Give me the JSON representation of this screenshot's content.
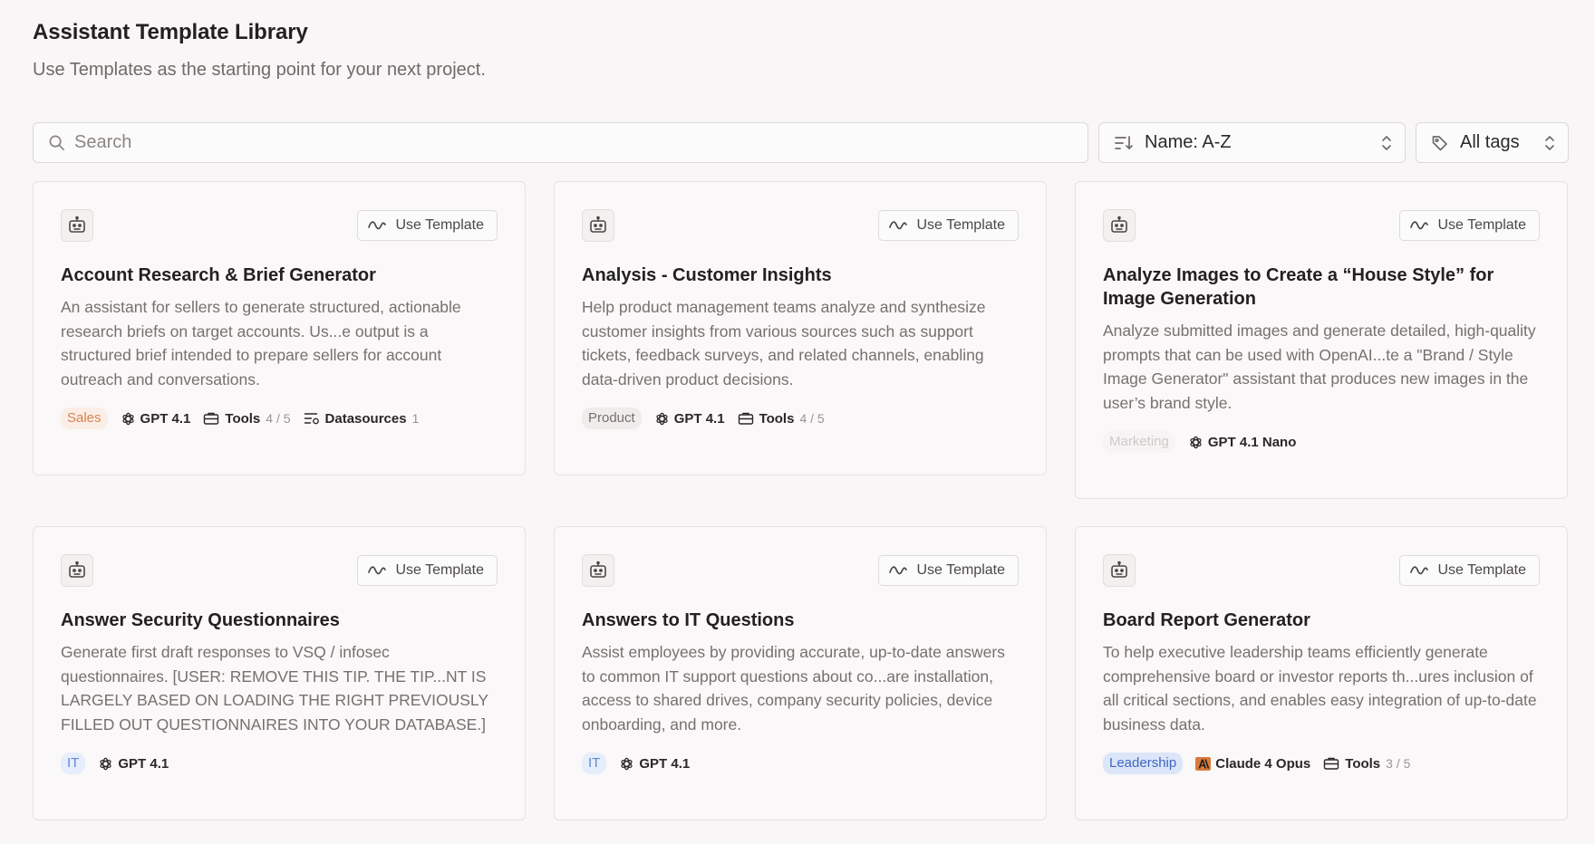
{
  "header": {
    "title": "Assistant Template Library",
    "subtitle": "Use Templates as the starting point for your next project."
  },
  "toolbar": {
    "search_placeholder": "Search",
    "sort_label": "Name: A-Z",
    "tags_label": "All tags"
  },
  "use_template_label": "Use Template",
  "cards": [
    {
      "title": "Account Research & Brief Generator",
      "description": "An assistant for sellers to generate structured, actionable research briefs on target accounts. Us...e output is a structured brief intended to prepare sellers for account outreach and conversations.",
      "tag": "Sales",
      "model": "GPT 4.1",
      "tools_label": "Tools",
      "tools_count": "4 / 5",
      "datasources_label": "Datasources",
      "datasources_count": "1"
    },
    {
      "title": "Analysis - Customer Insights",
      "description": "Help product management teams analyze and synthesize customer insights from various sources such as support tickets, feedback surveys, and related channels, enabling data-driven product decisions.",
      "tag": "Product",
      "model": "GPT 4.1",
      "tools_label": "Tools",
      "tools_count": "4 / 5"
    },
    {
      "title": "Analyze Images to Create a “House Style” for Image Generation",
      "description": "Analyze submitted images and generate detailed, high-quality prompts that can be used with OpenAI...te a \"Brand / Style Image Generator\" assistant that produces new images in the user’s brand style.",
      "tag": "Marketing",
      "model": "GPT 4.1 Nano"
    },
    {
      "title": "Answer Security Questionnaires",
      "description": "Generate first draft responses to VSQ / infosec questionnaires. [USER: REMOVE THIS TIP. THE TIP...NT IS LARGELY BASED ON LOADING THE RIGHT PREVIOUSLY FILLED OUT QUESTIONNAIRES INTO YOUR DATABASE.]",
      "tag": "IT",
      "model": "GPT 4.1"
    },
    {
      "title": "Answers to IT Questions",
      "description": "Assist employees by providing accurate, up-to-date answers to common IT support questions about co...are installation, access to shared drives, company security policies, device onboarding, and more.",
      "tag": "IT",
      "model": "GPT 4.1"
    },
    {
      "title": "Board Report Generator",
      "description": "To help executive leadership teams efficiently generate comprehensive board or investor reports th...ures inclusion of all critical sections, and enables easy integration of up-to-date business data.",
      "tag": "Leadership",
      "model": "Claude 4 Opus",
      "tools_label": "Tools",
      "tools_count": "3 / 5"
    }
  ],
  "icons": {
    "card_icon": "robot-icon",
    "use_template_icon": "wave-icon",
    "openai_model_icon": "openai-icon",
    "anthropic_model_icon": "anthropic-icon",
    "tools_icon": "toolbox-icon",
    "datasources_icon": "datasource-list-icon",
    "search_icon": "search-icon",
    "sort_icon": "sort-icon",
    "tags_icon": "tag-icon",
    "select_icon": "chevron-updown-icon"
  },
  "colors": {
    "background": "#f8f6f6",
    "card_background": "#faf8f8",
    "tag_sales": "#d9824f",
    "tag_it": "#5f88cd",
    "tag_leadership": "#3c67c0",
    "anthropic_brand": "#d97a3a"
  }
}
